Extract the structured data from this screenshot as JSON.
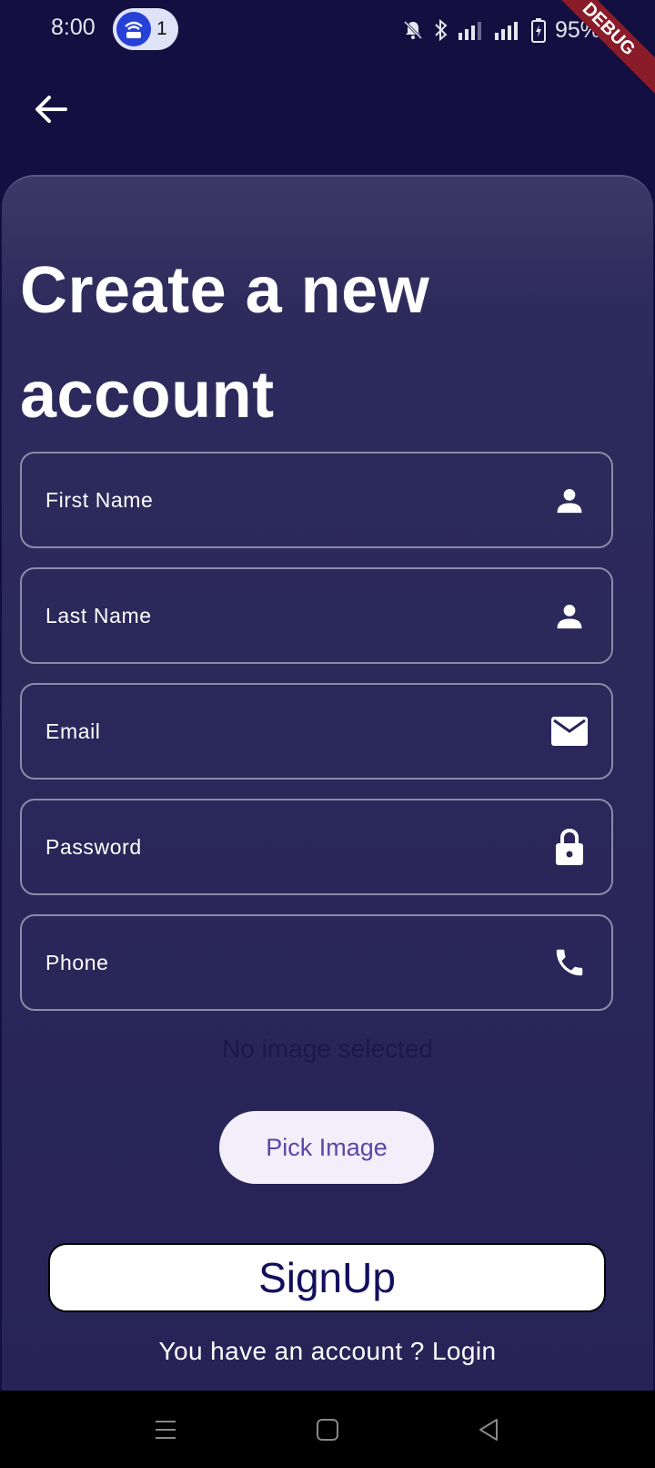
{
  "status_bar": {
    "time": "8:00",
    "notification_count": "1",
    "battery": "95%",
    "debug_label": "DEBUG"
  },
  "title": "Create a new account",
  "fields": {
    "first_name": "First Name",
    "last_name": "Last Name",
    "email": "Email",
    "password": "Password",
    "phone": "Phone"
  },
  "image_status": "No image selected",
  "pick_image_label": "Pick Image",
  "signup_label": "SignUp",
  "login_prompt": "You have an account ? Login",
  "colors": {
    "background": "#130f40",
    "card": "#272357",
    "signup_text": "#130f5c",
    "pick_text": "#5b46a6"
  }
}
